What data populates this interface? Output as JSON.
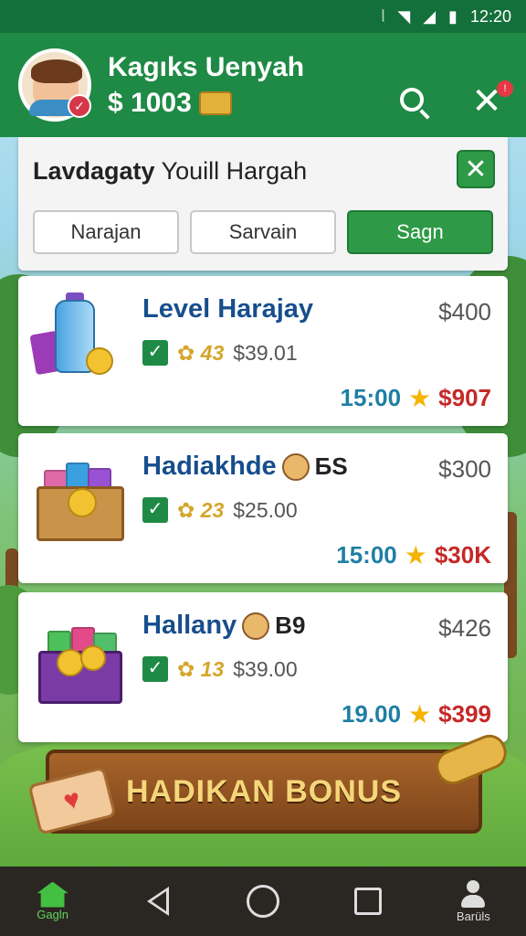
{
  "status_bar": {
    "time": "12:20"
  },
  "header": {
    "user_name": "Kagıks Uenyah",
    "balance": "$ 1003",
    "notification_count": "!"
  },
  "filter_panel": {
    "title_bold": "Lavdagaty",
    "title_rest": "Youill Hargah",
    "tabs": [
      {
        "label": "Narajan",
        "active": false
      },
      {
        "label": "Sarvain",
        "active": false
      },
      {
        "label": "Sagn",
        "active": true
      }
    ]
  },
  "cards": [
    {
      "title": "Level Harajay",
      "extra": "",
      "price": "$400",
      "coins": "43",
      "amount": "$39.01",
      "time": "15:00",
      "reward": "$907"
    },
    {
      "title": "Hadiakhde",
      "extra": "БS",
      "price": "$300",
      "coins": "23",
      "amount": "$25.00",
      "time": "15:00",
      "reward": "$30K"
    },
    {
      "title": "Hallany",
      "extra": "B9",
      "price": "$426",
      "coins": "13",
      "amount": "$39.00",
      "time": "19.00",
      "reward": "$399"
    }
  ],
  "bonus": {
    "label": "HADIKAN BONUS"
  },
  "nav": {
    "home_label": "Gagln",
    "profile_label": "Barüls"
  },
  "colors": {
    "primary_green": "#1f8a45",
    "title_blue": "#174e8c",
    "reward_red": "#c62828",
    "timer_blue": "#1f7fa4"
  }
}
